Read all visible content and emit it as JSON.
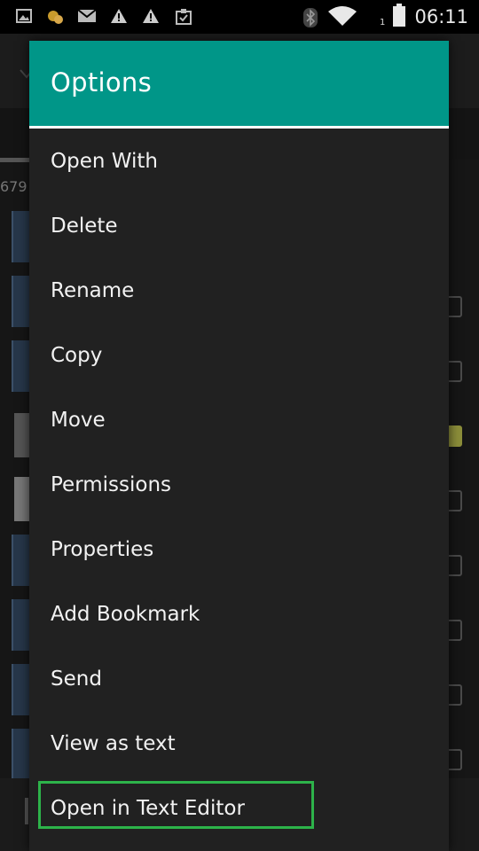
{
  "status_bar": {
    "time": "06:11",
    "sim_slot": "1",
    "icons": [
      "image-icon",
      "weather-icon",
      "gmail-icon",
      "warning-icon",
      "warning-icon",
      "clipboard-icon",
      "bluetooth-icon",
      "wifi-icon",
      "battery-icon"
    ]
  },
  "background": {
    "item_count_fragment": "679"
  },
  "dialog": {
    "title": "Options",
    "header_color": "#009688",
    "items": [
      {
        "label": "Open With"
      },
      {
        "label": "Delete"
      },
      {
        "label": "Rename"
      },
      {
        "label": "Copy"
      },
      {
        "label": "Move"
      },
      {
        "label": "Permissions"
      },
      {
        "label": "Properties"
      },
      {
        "label": "Add Bookmark"
      },
      {
        "label": "Send"
      },
      {
        "label": "View as text"
      },
      {
        "label": "Open in Text Editor"
      }
    ],
    "highlighted_item": "Open in Text Editor",
    "highlight_color": "#2db34a"
  }
}
